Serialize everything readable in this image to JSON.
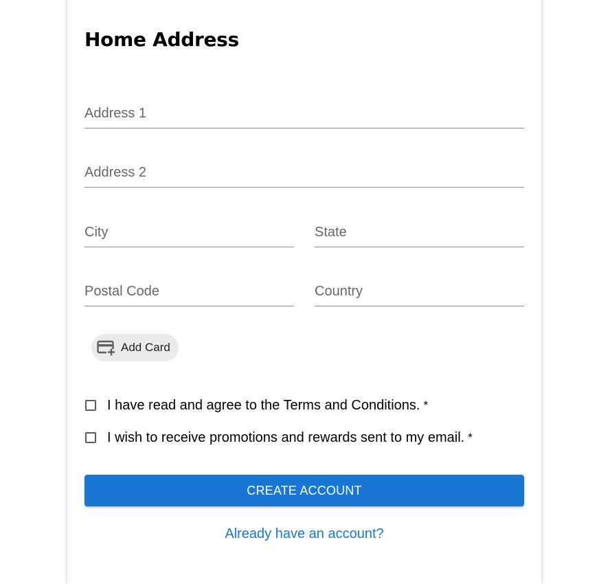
{
  "form": {
    "section_title": "Home Address",
    "fields": {
      "address1": {
        "label": "Address 1",
        "value": ""
      },
      "address2": {
        "label": "Address 2",
        "value": ""
      },
      "city": {
        "label": "City",
        "value": ""
      },
      "state": {
        "label": "State",
        "value": ""
      },
      "postal_code": {
        "label": "Postal Code",
        "value": ""
      },
      "country": {
        "label": "Country",
        "value": ""
      }
    },
    "add_card": {
      "label": "Add Card",
      "icon": "credit-card-plus-icon"
    },
    "checkboxes": [
      {
        "label": "I have read and agree to the Terms and Conditions.",
        "required_mark": "*",
        "checked": false
      },
      {
        "label": "I wish to receive promotions and rewards sent to my email.",
        "required_mark": "*",
        "checked": false
      }
    ],
    "submit_label": "CREATE ACCOUNT",
    "signin_link": "Already have an account?"
  },
  "colors": {
    "primary": "#1976d2",
    "label_gray": "#666666",
    "chip_background": "#ebebeb"
  }
}
